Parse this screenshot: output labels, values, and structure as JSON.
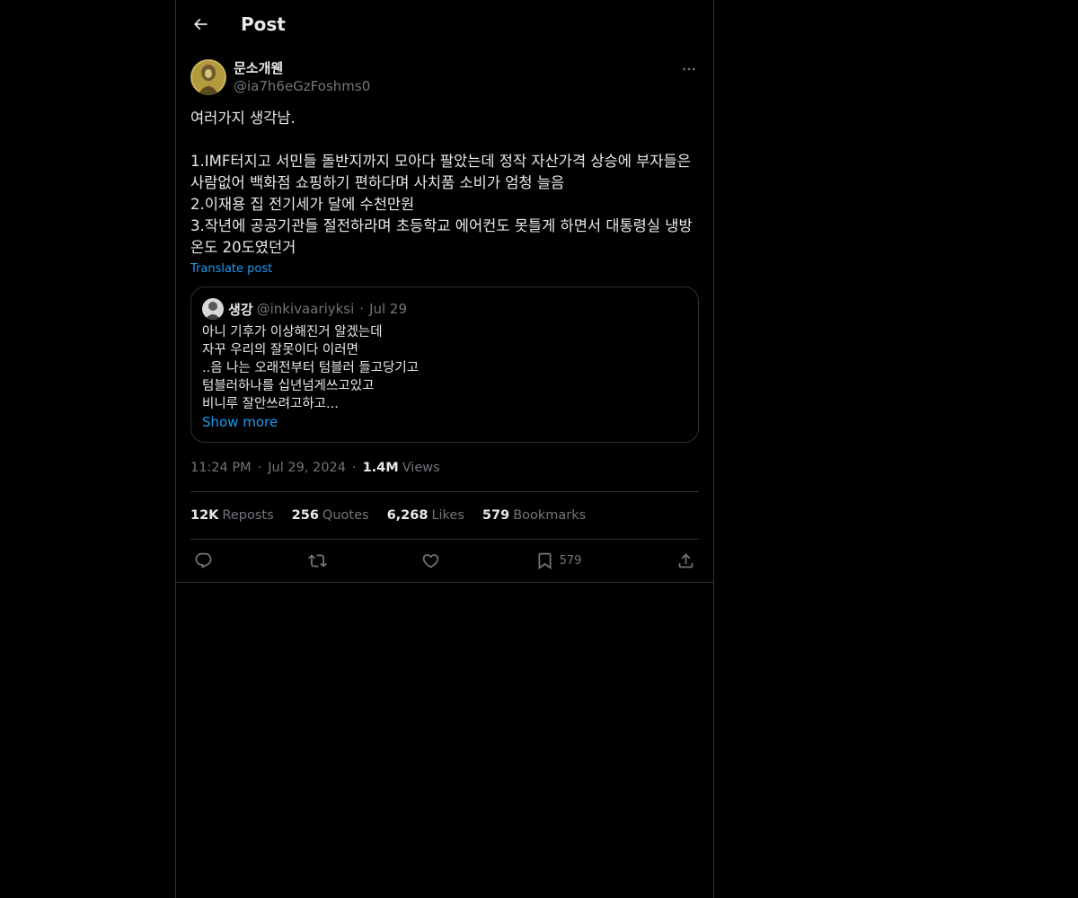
{
  "header": {
    "title": "Post",
    "back_icon": "arrow-left-icon"
  },
  "author": {
    "name": "문소개웬",
    "handle": "@ia7h6eGzFoshms0"
  },
  "post": {
    "text": "여러가지 생각남.\n\n1.IMF터지고 서민들 돌반지까지 모아다 팔았는데 정작 자산가격 상승에 부자들은 사람없어 백화점 쇼핑하기 편하다며 사치품 소비가 엄청 늘음\n2.이재용 집 전기세가 달에 수천만원\n3.작년에 공공기관들 절전하라며 초등학교 에어컨도 못틀게 하면서 대통령실 냉방 온도 20도였던거",
    "translate_label": "Translate post"
  },
  "quote": {
    "name": "생강",
    "handle": "@inkivaariyksi",
    "dot": "·",
    "date": "Jul 29",
    "text": "아니 기후가 이상해진거 알겠는데\n자꾸 우리의 잘못이다 이러면\n..음 나는 오래전부터 텀블러 들고당기고\n텀블러하나를 십년넘게쓰고있고\n비니루 잘안쓰려고하고...",
    "show_more": "Show more"
  },
  "meta": {
    "time": "11:24 PM",
    "sep": "·",
    "date": "Jul 29, 2024",
    "views_count": "1.4M",
    "views_label": "Views"
  },
  "stats": {
    "reposts": {
      "num": "12K",
      "label": "Reposts"
    },
    "quotes": {
      "num": "256",
      "label": "Quotes"
    },
    "likes": {
      "num": "6,268",
      "label": "Likes"
    },
    "bookmarks": {
      "num": "579",
      "label": "Bookmarks"
    }
  },
  "actions": {
    "reply_icon": "reply-icon",
    "repost_icon": "repost-icon",
    "like_icon": "heart-icon",
    "bookmark_icon": "bookmark-icon",
    "bookmark_count": "579",
    "share_icon": "share-icon"
  },
  "colors": {
    "background": "#000000",
    "text": "#e7e9ea",
    "muted": "#71767b",
    "link": "#1d9bf0",
    "border": "#2f3336"
  }
}
